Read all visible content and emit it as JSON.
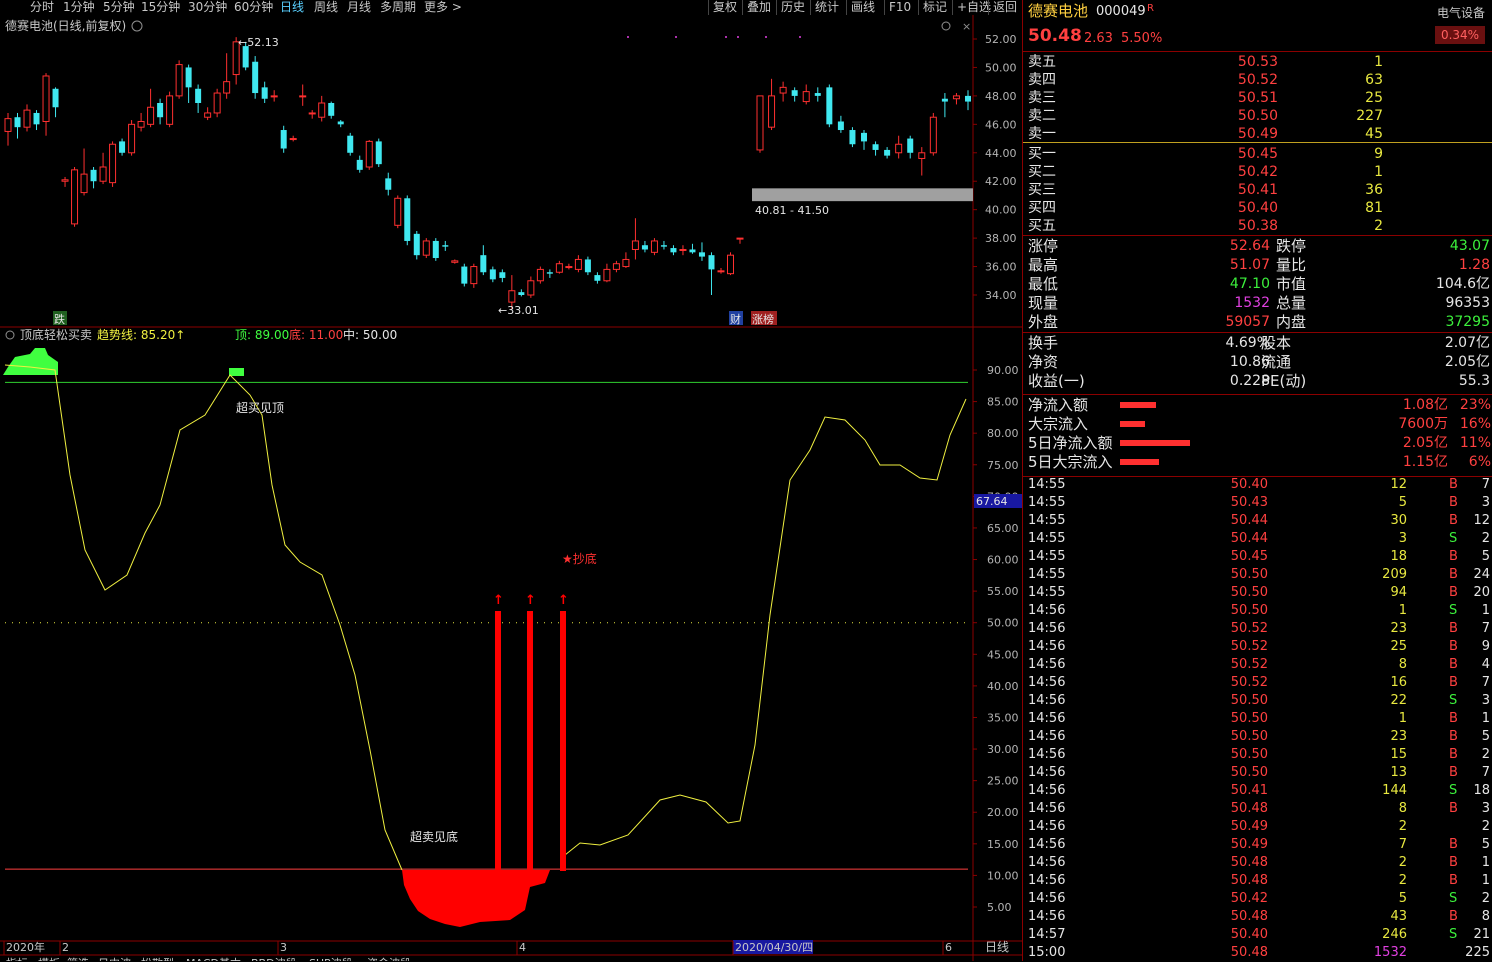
{
  "toolbar": {
    "periods": [
      "分时",
      "1分钟",
      "5分钟",
      "15分钟",
      "30分钟",
      "60分钟",
      "日线",
      "周线",
      "月线",
      "多周期",
      "更多 >"
    ],
    "active_period": "日线",
    "right_buttons": [
      "复权",
      "叠加",
      "历史",
      "统计",
      "画线",
      "F10",
      "标记",
      "+自选",
      "返回"
    ]
  },
  "price_panel": {
    "title": "德赛电池(日线,前复权)",
    "high_label": "52.13",
    "low_label": "33.01",
    "range_label": "40.81 - 41.50",
    "y_ticks": [
      "52.00",
      "50.00",
      "48.00",
      "46.00",
      "44.00",
      "42.00",
      "40.00",
      "38.00",
      "36.00",
      "34.00"
    ],
    "marker_die": "跌",
    "marker_cai": "财",
    "marker_zhangting": "涨榜"
  },
  "indicator_panel": {
    "name": "顶底轻松买卖",
    "trend_label": "趋势线: 85.20↑",
    "top_label": "顶: 89.00",
    "bottom_label": "底: 11.00",
    "mid_label": "中: 50.00",
    "current_value": "67.64",
    "annotation_top": "超买见顶",
    "annotation_bottom": "超卖见底",
    "annotation_buy": "★抄底",
    "y_ticks": [
      "90.00",
      "85.00",
      "80.00",
      "75.00",
      "70.00",
      "65.00",
      "60.00",
      "55.00",
      "50.00",
      "45.00",
      "40.00",
      "35.00",
      "30.00",
      "25.00",
      "20.00",
      "15.00",
      "10.00",
      "5.00"
    ]
  },
  "date_axis": {
    "labels": [
      "2020年",
      "2",
      "3",
      "4",
      "2020/04/30/四",
      "6"
    ],
    "right_label": "日线"
  },
  "chart_data": {
    "type": "candlestick",
    "title": "德赛电池(日线,前复权)",
    "ylim": [
      32.5,
      53
    ],
    "ohlc": [
      [
        45.5,
        46.4,
        44.5,
        46.8
      ],
      [
        46.5,
        45.8,
        45.0,
        46.8
      ],
      [
        45.8,
        47.0,
        45.5,
        47.4
      ],
      [
        46.8,
        46.0,
        45.6,
        47.0
      ],
      [
        46.2,
        49.4,
        45.2,
        49.6
      ],
      [
        48.5,
        47.2,
        46.5,
        48.6
      ],
      [
        42.0,
        42.1,
        41.6,
        42.3
      ],
      [
        39.0,
        42.8,
        38.8,
        43.0
      ],
      [
        41.2,
        42.5,
        41.0,
        44.3
      ],
      [
        42.8,
        42.0,
        41.5,
        43.0
      ],
      [
        42.0,
        43.0,
        41.8,
        44.0
      ],
      [
        41.9,
        44.6,
        41.6,
        44.8
      ],
      [
        44.8,
        44.0,
        43.8,
        45.0
      ],
      [
        44.0,
        46.0,
        43.8,
        46.3
      ],
      [
        45.8,
        46.2,
        45.5,
        46.8
      ],
      [
        46.0,
        47.2,
        45.8,
        48.5
      ],
      [
        47.5,
        46.5,
        46.0,
        47.8
      ],
      [
        46.0,
        48.0,
        45.8,
        48.3
      ],
      [
        48.0,
        50.2,
        47.8,
        50.5
      ],
      [
        50.0,
        48.6,
        47.5,
        50.2
      ],
      [
        48.5,
        47.5,
        46.8,
        48.8
      ],
      [
        46.5,
        46.8,
        46.3,
        47.2
      ],
      [
        46.8,
        48.2,
        46.5,
        48.5
      ],
      [
        48.2,
        49.0,
        47.8,
        51.0
      ],
      [
        49.5,
        51.8,
        48.8,
        52.13
      ],
      [
        51.5,
        50.0,
        49.8,
        51.8
      ],
      [
        50.4,
        48.2,
        47.8,
        50.8
      ],
      [
        48.6,
        47.8,
        47.5,
        49.0
      ],
      [
        48.0,
        48.0,
        47.6,
        48.4
      ],
      [
        45.6,
        44.3,
        44.0,
        45.9
      ],
      [
        45.0,
        45.0,
        44.8,
        45.2
      ],
      [
        48.0,
        48.0,
        47.3,
        48.8
      ],
      [
        46.8,
        46.8,
        46.4,
        47.0
      ],
      [
        46.5,
        47.5,
        46.2,
        48.0
      ],
      [
        47.5,
        46.6,
        46.4,
        47.6
      ],
      [
        46.2,
        46.0,
        45.8,
        46.3
      ],
      [
        45.2,
        44.0,
        43.8,
        45.4
      ],
      [
        43.5,
        42.8,
        42.6,
        43.8
      ],
      [
        43.0,
        44.8,
        42.8,
        44.9
      ],
      [
        44.8,
        43.2,
        43.0,
        45.0
      ],
      [
        42.2,
        41.4,
        41.0,
        42.6
      ],
      [
        38.9,
        40.8,
        38.7,
        41.0
      ],
      [
        40.8,
        37.8,
        37.5,
        41.0
      ],
      [
        38.3,
        36.8,
        36.5,
        38.5
      ],
      [
        36.8,
        37.8,
        36.6,
        38.0
      ],
      [
        37.8,
        36.6,
        36.4,
        38.0
      ],
      [
        37.5,
        37.4,
        37.1,
        37.8
      ],
      [
        36.3,
        36.4,
        36.2,
        36.5
      ],
      [
        36.0,
        34.8,
        34.6,
        36.2
      ],
      [
        34.8,
        36.0,
        34.5,
        36.2
      ],
      [
        36.8,
        35.6,
        35.4,
        37.5
      ],
      [
        35.8,
        35.1,
        34.9,
        36.0
      ],
      [
        35.6,
        35.2,
        34.9,
        35.8
      ],
      [
        33.5,
        34.3,
        33.01,
        35.4
      ],
      [
        34.2,
        34.0,
        33.9,
        34.4
      ],
      [
        34.0,
        35.0,
        33.8,
        35.3
      ],
      [
        35.0,
        35.8,
        34.8,
        36.0
      ],
      [
        35.6,
        35.5,
        35.2,
        35.8
      ],
      [
        35.6,
        36.2,
        35.5,
        36.4
      ],
      [
        36.0,
        36.0,
        35.8,
        36.2
      ],
      [
        35.8,
        36.5,
        35.6,
        36.8
      ],
      [
        36.5,
        35.6,
        35.4,
        36.7
      ],
      [
        35.4,
        35.0,
        34.8,
        35.6
      ],
      [
        35.0,
        35.8,
        34.9,
        36.2
      ],
      [
        35.8,
        36.2,
        35.6,
        36.4
      ],
      [
        36.0,
        36.5,
        35.9,
        37.0
      ],
      [
        37.2,
        37.8,
        36.5,
        39.4
      ],
      [
        37.5,
        37.2,
        37.0,
        37.8
      ],
      [
        37.0,
        37.8,
        36.8,
        38.0
      ],
      [
        37.5,
        37.4,
        37.2,
        37.8
      ],
      [
        37.3,
        37.0,
        36.8,
        37.5
      ],
      [
        37.2,
        37.2,
        36.8,
        37.5
      ],
      [
        37.2,
        37.0,
        36.9,
        37.6
      ],
      [
        37.0,
        36.7,
        36.4,
        37.7
      ],
      [
        36.8,
        35.8,
        34.0,
        37.0
      ],
      [
        35.7,
        35.7,
        35.5,
        35.9
      ],
      [
        35.5,
        36.8,
        35.4,
        37.0
      ],
      [
        38.0,
        38.0,
        37.6,
        38.0
      ]
    ],
    "indicator_series": {
      "name": "趋势线",
      "reference_levels": {
        "top": 89,
        "mid": 50,
        "bottom": 11
      },
      "last_value": 67.64
    }
  },
  "quote": {
    "stock_name": "德赛电池",
    "stock_code": "000049",
    "badge": "R",
    "sector": "电气设备",
    "sector_change": "0.34%",
    "price": "50.48",
    "change": "2.63",
    "change_pct": "5.50%",
    "asks": [
      {
        "label": "卖五",
        "price": "50.53",
        "vol": "1"
      },
      {
        "label": "卖四",
        "price": "50.52",
        "vol": "63"
      },
      {
        "label": "卖三",
        "price": "50.51",
        "vol": "25"
      },
      {
        "label": "卖二",
        "price": "50.50",
        "vol": "227"
      },
      {
        "label": "卖一",
        "price": "50.49",
        "vol": "45"
      }
    ],
    "bids": [
      {
        "label": "买一",
        "price": "50.45",
        "vol": "9"
      },
      {
        "label": "买二",
        "price": "50.42",
        "vol": "1"
      },
      {
        "label": "买三",
        "price": "50.41",
        "vol": "36"
      },
      {
        "label": "买四",
        "price": "50.40",
        "vol": "81"
      },
      {
        "label": "买五",
        "price": "50.38",
        "vol": "2"
      }
    ],
    "stats_left": [
      {
        "label": "涨停",
        "value": "52.64"
      },
      {
        "label": "最高",
        "value": "51.07"
      },
      {
        "label": "最低",
        "value": "47.10"
      },
      {
        "label": "现量",
        "value": "1532"
      },
      {
        "label": "外盘",
        "value": "59057"
      }
    ],
    "stats_right": [
      {
        "label": "跌停",
        "value": "43.07"
      },
      {
        "label": "量比",
        "value": "1.28"
      },
      {
        "label": "市值",
        "value": "104.6亿"
      },
      {
        "label": "总量",
        "value": "96353"
      },
      {
        "label": "内盘",
        "value": "37295"
      }
    ],
    "stats2_left": [
      {
        "label": "换手",
        "value": "4.69%"
      },
      {
        "label": "净资",
        "value": "10.86"
      },
      {
        "label": "收益(一)",
        "value": "0.228"
      }
    ],
    "stats2_right": [
      {
        "label": "股本",
        "value": "2.07亿"
      },
      {
        "label": "流通",
        "value": "2.05亿"
      },
      {
        "label": "PE(动)",
        "value": "55.3"
      }
    ],
    "flows": [
      {
        "label": "净流入额",
        "value": "1.08亿",
        "pct": "23%",
        "bar": 0.23
      },
      {
        "label": "大宗流入",
        "value": "7600万",
        "pct": "16%",
        "bar": 0.16
      },
      {
        "label": "5日净流入额",
        "value": "2.05亿",
        "pct": "11%",
        "bar": 0.45
      },
      {
        "label": "5日大宗流入",
        "value": "1.15亿",
        "pct": "6%",
        "bar": 0.25
      }
    ],
    "ticks": [
      {
        "t": "14:55",
        "p": "50.40",
        "v": "12",
        "d": "B",
        "n": "7"
      },
      {
        "t": "14:55",
        "p": "50.43",
        "v": "5",
        "d": "B",
        "n": "3"
      },
      {
        "t": "14:55",
        "p": "50.44",
        "v": "30",
        "d": "B",
        "n": "12"
      },
      {
        "t": "14:55",
        "p": "50.44",
        "v": "3",
        "d": "S",
        "n": "2"
      },
      {
        "t": "14:55",
        "p": "50.45",
        "v": "18",
        "d": "B",
        "n": "5"
      },
      {
        "t": "14:55",
        "p": "50.50",
        "v": "209",
        "d": "B",
        "n": "24"
      },
      {
        "t": "14:55",
        "p": "50.50",
        "v": "94",
        "d": "B",
        "n": "20"
      },
      {
        "t": "14:56",
        "p": "50.50",
        "v": "1",
        "d": "S",
        "n": "1"
      },
      {
        "t": "14:56",
        "p": "50.52",
        "v": "23",
        "d": "B",
        "n": "7"
      },
      {
        "t": "14:56",
        "p": "50.52",
        "v": "25",
        "d": "B",
        "n": "9"
      },
      {
        "t": "14:56",
        "p": "50.52",
        "v": "8",
        "d": "B",
        "n": "4"
      },
      {
        "t": "14:56",
        "p": "50.52",
        "v": "16",
        "d": "B",
        "n": "7"
      },
      {
        "t": "14:56",
        "p": "50.50",
        "v": "22",
        "d": "S",
        "n": "3"
      },
      {
        "t": "14:56",
        "p": "50.50",
        "v": "1",
        "d": "B",
        "n": "1"
      },
      {
        "t": "14:56",
        "p": "50.50",
        "v": "23",
        "d": "B",
        "n": "5"
      },
      {
        "t": "14:56",
        "p": "50.50",
        "v": "15",
        "d": "B",
        "n": "2"
      },
      {
        "t": "14:56",
        "p": "50.50",
        "v": "13",
        "d": "B",
        "n": "7"
      },
      {
        "t": "14:56",
        "p": "50.41",
        "v": "144",
        "d": "S",
        "n": "18"
      },
      {
        "t": "14:56",
        "p": "50.48",
        "v": "8",
        "d": "B",
        "n": "3"
      },
      {
        "t": "14:56",
        "p": "50.49",
        "v": "2",
        "d": "",
        "n": "2"
      },
      {
        "t": "14:56",
        "p": "50.49",
        "v": "7",
        "d": "B",
        "n": "5"
      },
      {
        "t": "14:56",
        "p": "50.48",
        "v": "2",
        "d": "B",
        "n": "1"
      },
      {
        "t": "14:56",
        "p": "50.48",
        "v": "2",
        "d": "B",
        "n": "1"
      },
      {
        "t": "14:56",
        "p": "50.42",
        "v": "5",
        "d": "S",
        "n": "2"
      },
      {
        "t": "14:56",
        "p": "50.48",
        "v": "43",
        "d": "B",
        "n": "8"
      },
      {
        "t": "14:57",
        "p": "50.40",
        "v": "246",
        "d": "S",
        "n": "21"
      },
      {
        "t": "15:00",
        "p": "50.48",
        "v": "1532",
        "d": "",
        "n": "225"
      }
    ]
  },
  "bottom_tabs": [
    "指标",
    "模板",
    "筛选",
    "日内波",
    "松散型",
    "MACD基本",
    "BBD波段",
    "SUP波段",
    "资金波段"
  ],
  "colors": {
    "up": "#ff3030",
    "down": "#40e8f0",
    "grid": "#8b0000",
    "trend": "#f0f040",
    "signal": "#ff0000",
    "green": "#40ff40"
  }
}
